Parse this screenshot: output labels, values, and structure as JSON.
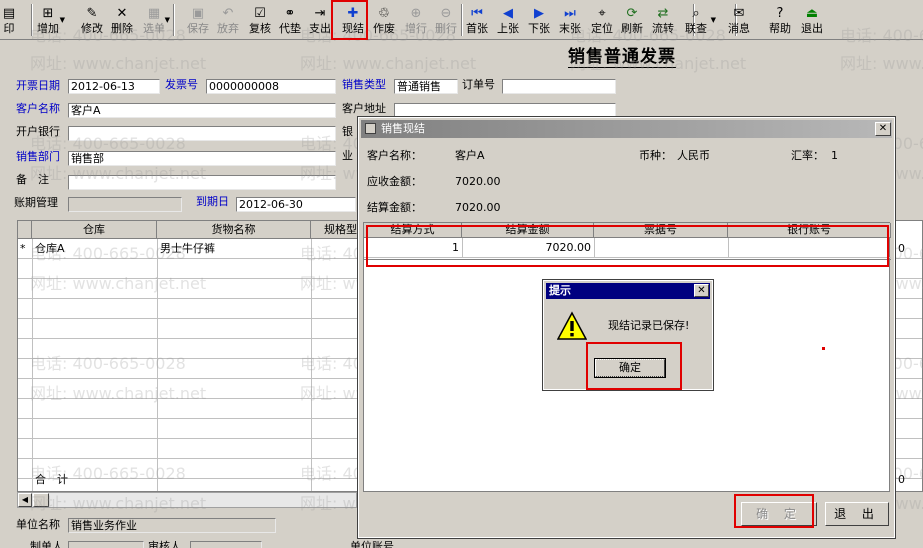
{
  "toolbar": {
    "items": [
      {
        "label": "印",
        "icon": "print-icon"
      },
      {
        "label": "增加",
        "icon": "add-icon"
      },
      {
        "label": "修改",
        "icon": "edit-icon"
      },
      {
        "label": "删除",
        "icon": "delete-icon"
      },
      {
        "label": "选单",
        "icon": "select-icon"
      },
      {
        "label": "保存",
        "icon": "save-icon"
      },
      {
        "label": "放弃",
        "icon": "undo-icon"
      },
      {
        "label": "复核",
        "icon": "review-icon"
      },
      {
        "label": "代垫",
        "icon": "advance-icon"
      },
      {
        "label": "支出",
        "icon": "expense-icon"
      },
      {
        "label": "现结",
        "icon": "settle-icon"
      },
      {
        "label": "作废",
        "icon": "void-icon"
      },
      {
        "label": "增行",
        "icon": "add-row-icon"
      },
      {
        "label": "删行",
        "icon": "delete-row-icon"
      },
      {
        "label": "首张",
        "icon": "first-icon"
      },
      {
        "label": "上张",
        "icon": "prev-icon"
      },
      {
        "label": "下张",
        "icon": "next-icon"
      },
      {
        "label": "末张",
        "icon": "last-icon"
      },
      {
        "label": "定位",
        "icon": "locate-icon"
      },
      {
        "label": "刷新",
        "icon": "refresh-icon"
      },
      {
        "label": "流转",
        "icon": "flow-icon"
      },
      {
        "label": "联查",
        "icon": "query-icon"
      },
      {
        "label": "消息",
        "icon": "message-icon"
      },
      {
        "label": "帮助",
        "icon": "help-icon"
      },
      {
        "label": "退出",
        "icon": "exit-icon"
      }
    ]
  },
  "form": {
    "title": "销售普通发票",
    "invoice_date_label": "开票日期",
    "invoice_date": "2012-06-13",
    "invoice_no_label": "发票号",
    "invoice_no": "0000000008",
    "sales_type_label": "销售类型",
    "sales_type": "普通销售",
    "order_no_label": "订单号",
    "customer_label": "客户名称",
    "customer": "客户A",
    "customer_addr_label": "客户地址",
    "bank_label": "开户银行",
    "bank_label_cut": "银",
    "dept_label": "销售部门",
    "dept": "销售部",
    "dept_label_cut": "业",
    "remark_label": "备　注",
    "account_period_label": "账期管理",
    "due_date_label": "到期日",
    "due_date": "2012-06-30",
    "unit_name_label": "单位名称",
    "unit_name": "销售业务作业",
    "maker_label": "制单人",
    "reviewer_label": "审核人",
    "unit_account_label": "单位账号"
  },
  "grid": {
    "columns": [
      "仓库",
      "货物名称",
      "规格型"
    ],
    "rows": [
      {
        "marker": "*",
        "warehouse": "仓库A",
        "product": "男士牛仔裤"
      }
    ],
    "total_label": "合　计",
    "right_edge_values": [
      "0",
      "0"
    ]
  },
  "settle_dialog": {
    "title": "销售现结",
    "customer_label": "客户名称：",
    "customer": "客户A",
    "currency_label": "币种：",
    "currency": "人民币",
    "rate_label": "汇率：",
    "rate": "1",
    "receivable_label": "应收金额：",
    "receivable": "7020.00",
    "settled_label": "结算金额：",
    "settled": "7020.00",
    "columns": [
      "结算方式",
      "结算金额",
      "票据号",
      "银行账号"
    ],
    "rows": [
      {
        "method": "1",
        "amount": "7020.00",
        "bill_no": "",
        "bank_account": ""
      }
    ],
    "ok_label": "确 定",
    "exit_label": "退 出"
  },
  "prompt": {
    "title": "提示",
    "message": "现结记录已保存!",
    "ok_label": "确定"
  },
  "watermarks": {
    "phone": "电话: 400-665-0028",
    "site": "网址: www.chanjet.net"
  },
  "colors": {
    "highlight": "#e00000",
    "label_blue": "#0000c8",
    "title_bar_active": "#000080"
  }
}
